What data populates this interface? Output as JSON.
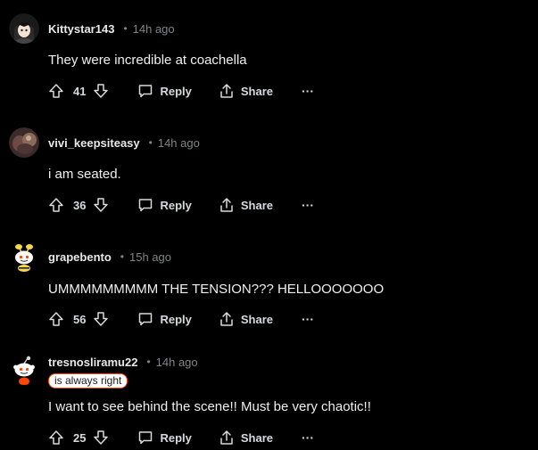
{
  "comments": [
    {
      "username": "Kittystar143",
      "time": "14h ago",
      "body": "They were incredible at coachella",
      "score": "41",
      "avatar_icon": "avatar-dark-hair-icon",
      "avatar_color": "#2b2b2b"
    },
    {
      "username": "vivi_keepsiteasy",
      "time": "14h ago",
      "body": "i am seated.",
      "score": "36",
      "avatar_icon": "avatar-photo-icon",
      "avatar_color": "#5a3b3b"
    },
    {
      "username": "grapebento",
      "time": "15h ago",
      "body": "UMMMMMMMMM THE TENSION??? HELLOOOOOOO",
      "score": "56",
      "avatar_icon": "snoo-bee-icon",
      "avatar_color": "#f5d94a"
    },
    {
      "username": "tresnosliramu22",
      "time": "14h ago",
      "flair": "is always right",
      "body": "I want to see behind the scene!! Must be very chaotic!!",
      "score": "25",
      "avatar_icon": "snoo-icon",
      "avatar_color": "#ff4500"
    }
  ],
  "labels": {
    "separator": "•",
    "reply": "Reply",
    "share": "Share",
    "more": "···"
  },
  "colors": {
    "background": "#000000",
    "muted": "#818384",
    "text": "#d7dadc",
    "flair_border": "#ff4500"
  }
}
